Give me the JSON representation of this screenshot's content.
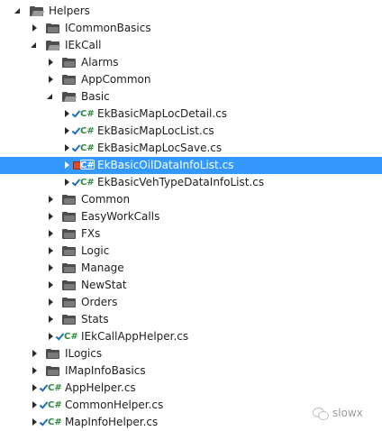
{
  "tree": {
    "items": [
      {
        "label": "Helpers",
        "kind": "folder",
        "state": "open",
        "depth": 0
      },
      {
        "label": "ICommonBasics",
        "kind": "folder",
        "state": "closed",
        "depth": 1
      },
      {
        "label": "IEkCall",
        "kind": "folder",
        "state": "open",
        "depth": 1
      },
      {
        "label": "Alarms",
        "kind": "folder",
        "state": "closed",
        "depth": 2
      },
      {
        "label": "AppCommon",
        "kind": "folder",
        "state": "closed",
        "depth": 2
      },
      {
        "label": "Basic",
        "kind": "folder",
        "state": "open",
        "depth": 2
      },
      {
        "label": "EkBasicMapLocDetail.cs",
        "kind": "cs",
        "state": "closed",
        "depth": 3,
        "status": "checked-in"
      },
      {
        "label": "EkBasicMapLocList.cs",
        "kind": "cs",
        "state": "closed",
        "depth": 3,
        "status": "checked-in"
      },
      {
        "label": "EkBasicMapLocSave.cs",
        "kind": "cs",
        "state": "closed",
        "depth": 3,
        "status": "checked-in"
      },
      {
        "label": "EkBasicOilDataInfoList.cs",
        "kind": "cs",
        "state": "closed",
        "depth": 3,
        "status": "checked-out",
        "selected": true
      },
      {
        "label": "EkBasicVehTypeDataInfoList.cs",
        "kind": "cs",
        "state": "closed",
        "depth": 3,
        "status": "checked-in"
      },
      {
        "label": "Common",
        "kind": "folder",
        "state": "closed",
        "depth": 2
      },
      {
        "label": "EasyWorkCalls",
        "kind": "folder",
        "state": "closed",
        "depth": 2
      },
      {
        "label": "FXs",
        "kind": "folder",
        "state": "closed",
        "depth": 2
      },
      {
        "label": "Logic",
        "kind": "folder",
        "state": "closed",
        "depth": 2
      },
      {
        "label": "Manage",
        "kind": "folder",
        "state": "closed",
        "depth": 2
      },
      {
        "label": "NewStat",
        "kind": "folder",
        "state": "closed",
        "depth": 2
      },
      {
        "label": "Orders",
        "kind": "folder",
        "state": "closed",
        "depth": 2
      },
      {
        "label": "Stats",
        "kind": "folder",
        "state": "closed",
        "depth": 2
      },
      {
        "label": "IEkCallAppHelper.cs",
        "kind": "cs",
        "state": "closed",
        "depth": 2,
        "status": "checked-in"
      },
      {
        "label": "ILogics",
        "kind": "folder",
        "state": "closed",
        "depth": 1
      },
      {
        "label": "IMapInfoBasics",
        "kind": "folder",
        "state": "closed",
        "depth": 1
      },
      {
        "label": "AppHelper.cs",
        "kind": "cs",
        "state": "closed",
        "depth": 1,
        "status": "checked-in"
      },
      {
        "label": "CommonHelper.cs",
        "kind": "cs",
        "state": "closed",
        "depth": 1,
        "status": "checked-in"
      },
      {
        "label": "MapInfoHelper.cs",
        "kind": "cs",
        "state": "closed",
        "depth": 1,
        "status": "checked-in"
      }
    ]
  },
  "cs_badge": "C#",
  "watermark": {
    "text": "slowx",
    "icon": "wechat-icon"
  },
  "colors": {
    "selection": "#3399ff",
    "csGreen": "#2e8b3a",
    "checkBlue": "#1f6fb8",
    "lockRed": "#d94b2b"
  }
}
